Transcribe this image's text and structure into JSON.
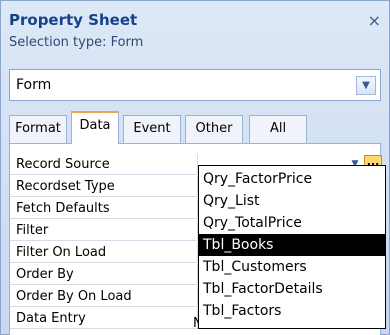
{
  "panel": {
    "title": "Property Sheet",
    "close_glyph": "×",
    "subtitle": "Selection type:  Form"
  },
  "selector": {
    "value": "Form",
    "arrow_icon": "chevron-down-icon"
  },
  "tabs": [
    {
      "label": "Format",
      "active": false
    },
    {
      "label": "Data",
      "active": true
    },
    {
      "label": "Event",
      "active": false
    },
    {
      "label": "Other",
      "active": false
    },
    {
      "label": "All",
      "active": false
    }
  ],
  "properties": [
    {
      "label": "Record Source"
    },
    {
      "label": "Recordset Type"
    },
    {
      "label": "Fetch Defaults"
    },
    {
      "label": "Filter"
    },
    {
      "label": "Filter On Load"
    },
    {
      "label": "Order By"
    },
    {
      "label": "Order By On Load"
    },
    {
      "label": "Data Entry"
    }
  ],
  "record_source": {
    "builder_label": "...",
    "options": [
      "Qry_FactorPrice",
      "Qry_List",
      "Qry_TotalPrice",
      "Tbl_Books",
      "Tbl_Customers",
      "Tbl_FactorDetails",
      "Tbl_Factors"
    ],
    "highlighted": "Tbl_Books"
  },
  "data_entry_partial": "No",
  "colors": {
    "title": "#15428b",
    "highlight": "#000000",
    "active_tab_accent": "#f0a347"
  }
}
